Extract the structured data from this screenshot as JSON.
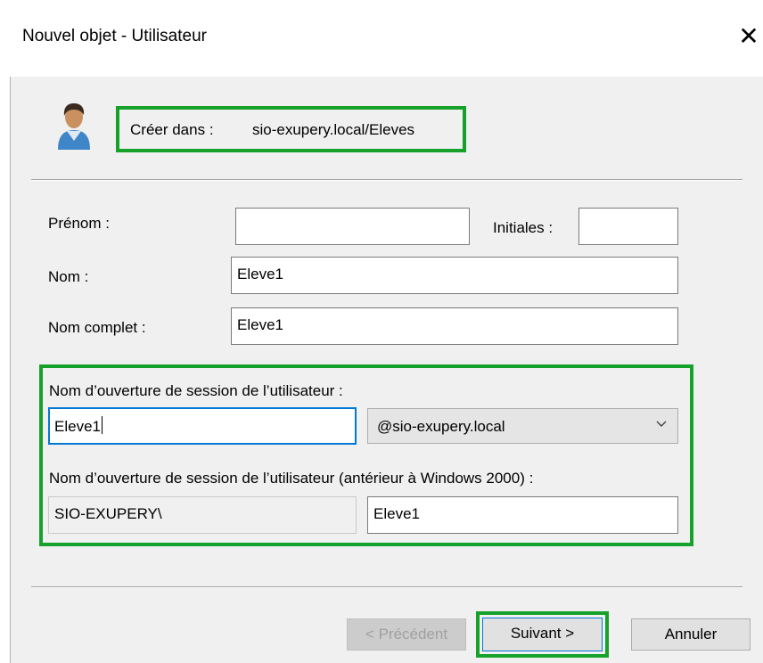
{
  "window": {
    "title": "Nouvel objet - Utilisateur",
    "close_glyph": "✕"
  },
  "header": {
    "create_in_label": "Créer dans :",
    "create_in_value": "sio-exupery.local/Eleves",
    "icon": "user-icon"
  },
  "form": {
    "first_name_label": "Prénom :",
    "first_name_value": "",
    "initials_label": "Initiales :",
    "initials_value": "",
    "last_name_label": "Nom :",
    "last_name_value": "Eleve1",
    "full_name_label": "Nom complet :",
    "full_name_value": "Eleve1",
    "logon_label": "Nom d’ouverture de session de l’utilisateur :",
    "logon_value": "Eleve1",
    "domain_selected": "@sio-exupery.local",
    "legacy_label": "Nom d’ouverture de session de l’utilisateur (antérieur à Windows 2000) :",
    "legacy_domain": "SIO-EXUPERY\\",
    "legacy_value": "Eleve1"
  },
  "buttons": {
    "back": "< Précédent",
    "next": "Suivant >",
    "cancel": "Annuler"
  },
  "colors": {
    "highlight": "#16a12a",
    "focus": "#0078d7",
    "dialog_bg": "#f0f0f0"
  }
}
